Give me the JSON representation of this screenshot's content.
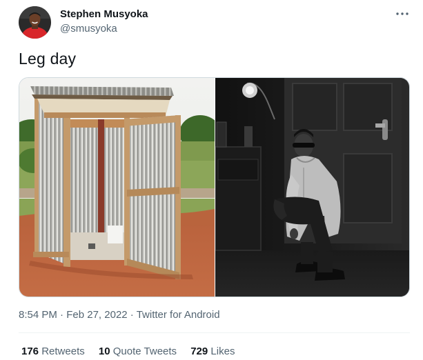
{
  "tweet": {
    "author": {
      "display_name": "Stephen Musyoka",
      "handle": "@smusyoka"
    },
    "more_icon": "more-horizontal-icon",
    "text": "Leg day",
    "media": [
      {
        "kind": "photo",
        "subject": "outdoor toilet"
      },
      {
        "kind": "photo",
        "subject": "squatting man"
      }
    ],
    "meta": {
      "time": "8:54 PM",
      "separator": " · ",
      "date": "Feb 27, 2022",
      "source": "Twitter for Android"
    },
    "stats": {
      "retweets_count": "176",
      "retweets_label": "Retweets",
      "quotes_count": "10",
      "quotes_label": "Quote Tweets",
      "likes_count": "729",
      "likes_label": "Likes"
    }
  }
}
